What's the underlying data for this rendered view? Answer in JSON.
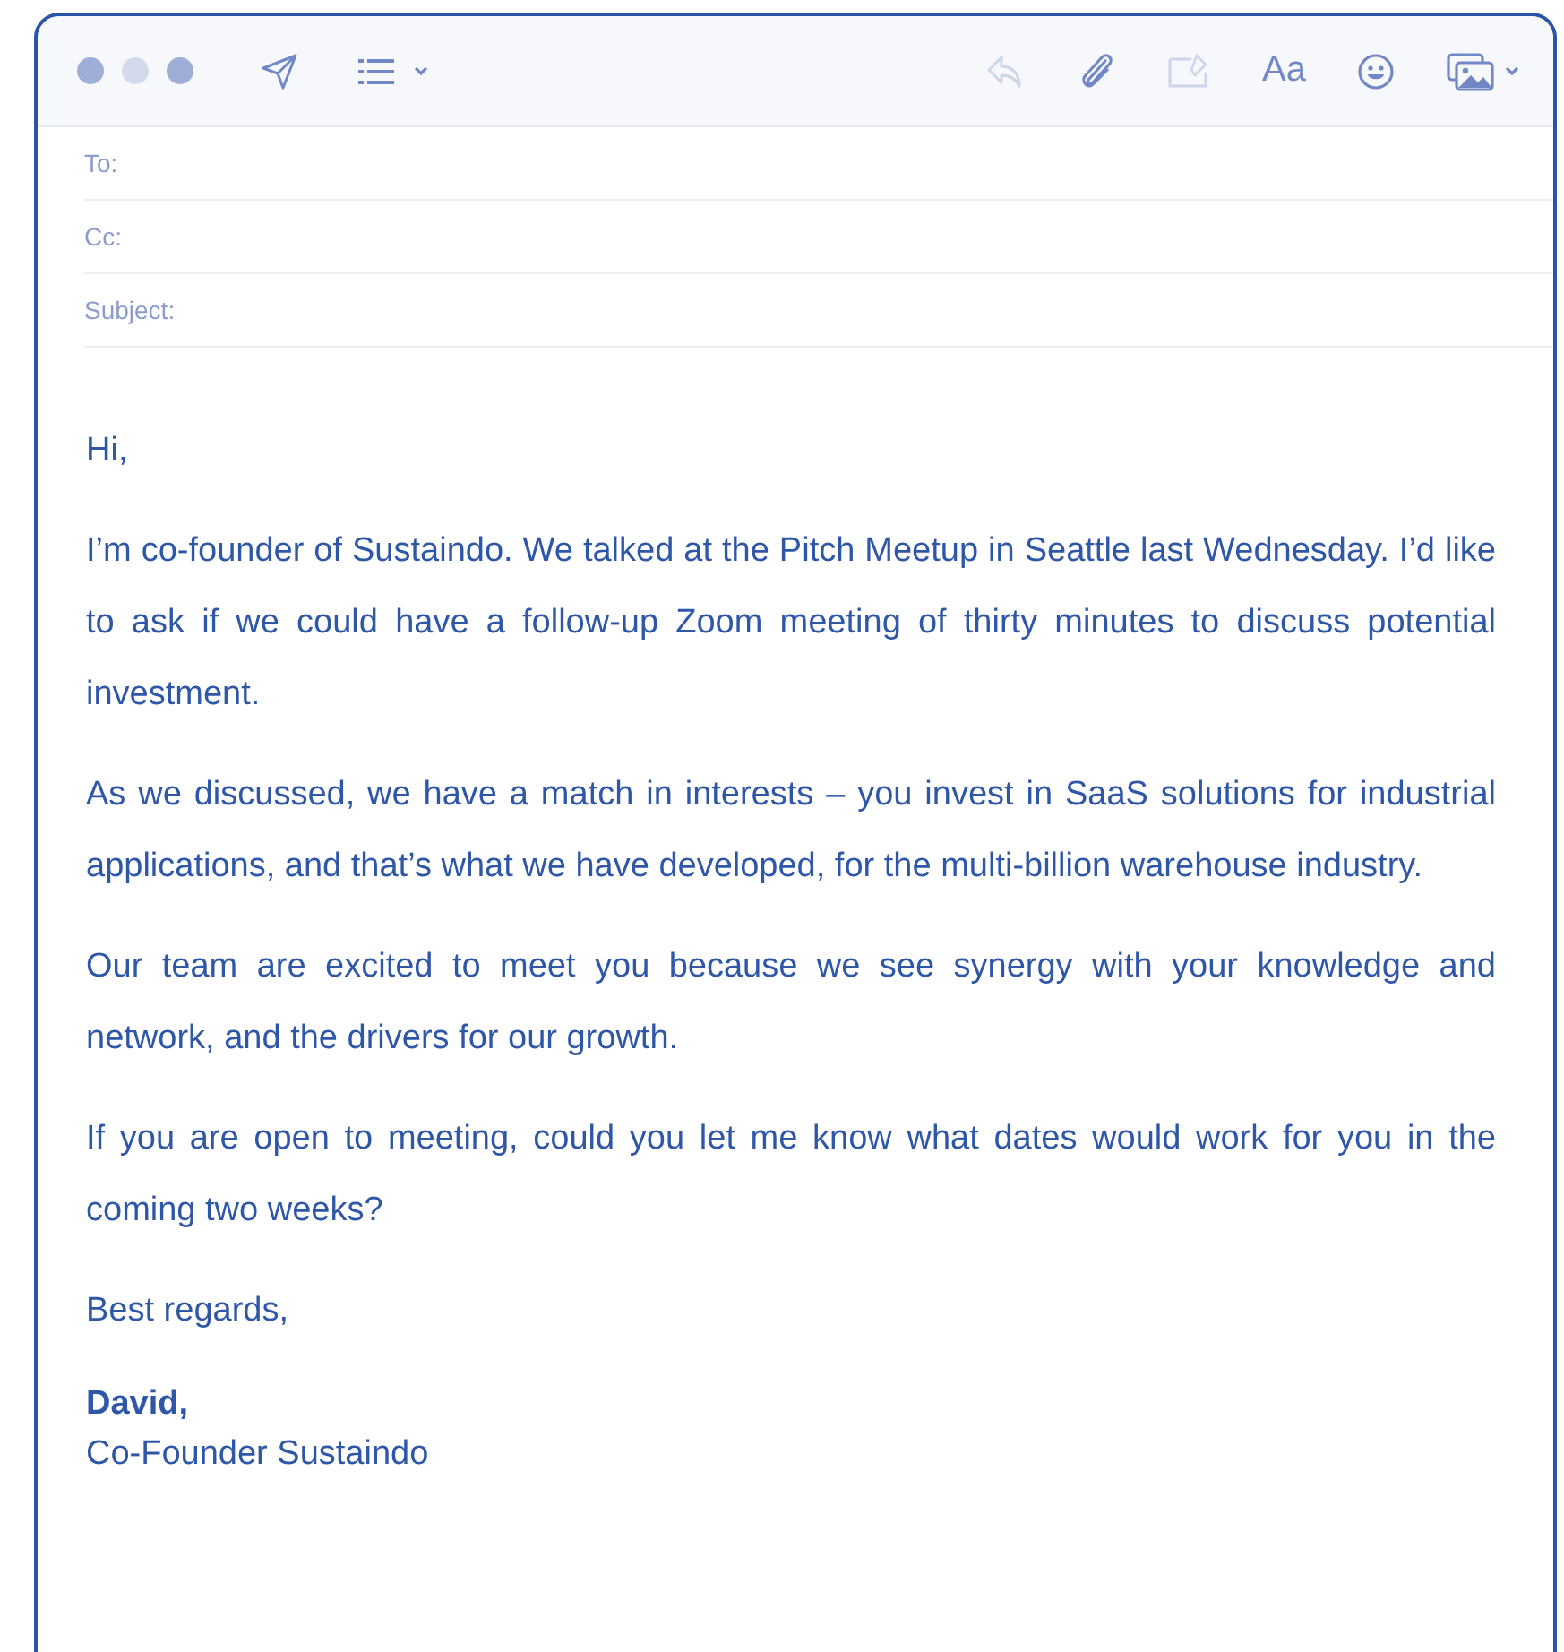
{
  "toolbar": {
    "left": [
      {
        "kind": "send",
        "disabled": false
      },
      {
        "kind": "list",
        "disabled": false
      }
    ],
    "right": [
      {
        "kind": "reply",
        "disabled": true
      },
      {
        "kind": "attach",
        "disabled": false
      },
      {
        "kind": "markup",
        "disabled": true
      },
      {
        "kind": "format",
        "label": "Aa",
        "disabled": false
      },
      {
        "kind": "emoji",
        "disabled": false
      },
      {
        "kind": "photo",
        "disabled": false
      }
    ]
  },
  "fields": [
    {
      "label": "To:"
    },
    {
      "label": "Cc:"
    },
    {
      "label": "Subject:"
    }
  ],
  "body": {
    "greeting": "Hi,",
    "paragraphs": [
      "I’m co-founder of Sustaindo. We talked at the Pitch Meetup in Seattle last Wednesday. I’d like to ask if we could have a follow-up Zoom meeting of thirty minutes to discuss potential investment.",
      "As we discussed, we have a match in interests – you invest in SaaS solutions for industrial applications, and that’s what we have developed, for the multi-billion warehouse industry.",
      "Our team are excited to meet you because we see synergy with your knowledge and network, and the drivers for our growth.",
      "If you are open to meeting, could you let me know what dates would work for you in the coming two weeks?"
    ],
    "closing": "Best regards,",
    "signature_name": "David,",
    "signature_title": "Co-Founder Sustaindo"
  }
}
